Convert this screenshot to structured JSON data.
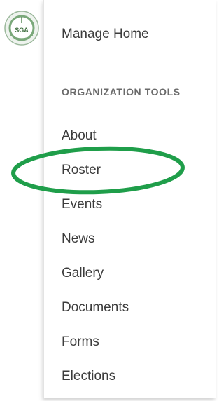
{
  "logo": {
    "text": "SGA",
    "ring_color": "#7aa87a",
    "icon": "organization-seal-icon"
  },
  "menu": {
    "top_item": "Manage Home",
    "section_heading": "ORGANIZATION TOOLS",
    "items": [
      {
        "label": "About"
      },
      {
        "label": "Roster"
      },
      {
        "label": "Events"
      },
      {
        "label": "News"
      },
      {
        "label": "Gallery"
      },
      {
        "label": "Documents"
      },
      {
        "label": "Forms"
      },
      {
        "label": "Elections"
      }
    ]
  },
  "annotation": {
    "highlighted_item": "Roster",
    "color": "#1f9e4a"
  }
}
